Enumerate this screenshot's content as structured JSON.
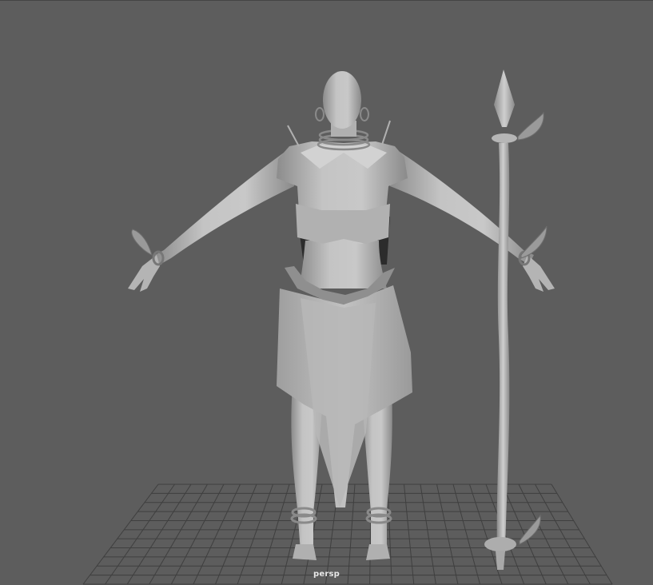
{
  "viewport": {
    "camera_label": "persp",
    "colors": {
      "background": "#5d5d5d",
      "grid_line": "#3f3f3f",
      "model_light": "#c9c9c9",
      "model_mid": "#a8a8a8",
      "model_dark": "#7e7e7e",
      "label_text": "#e8e8e8"
    }
  }
}
